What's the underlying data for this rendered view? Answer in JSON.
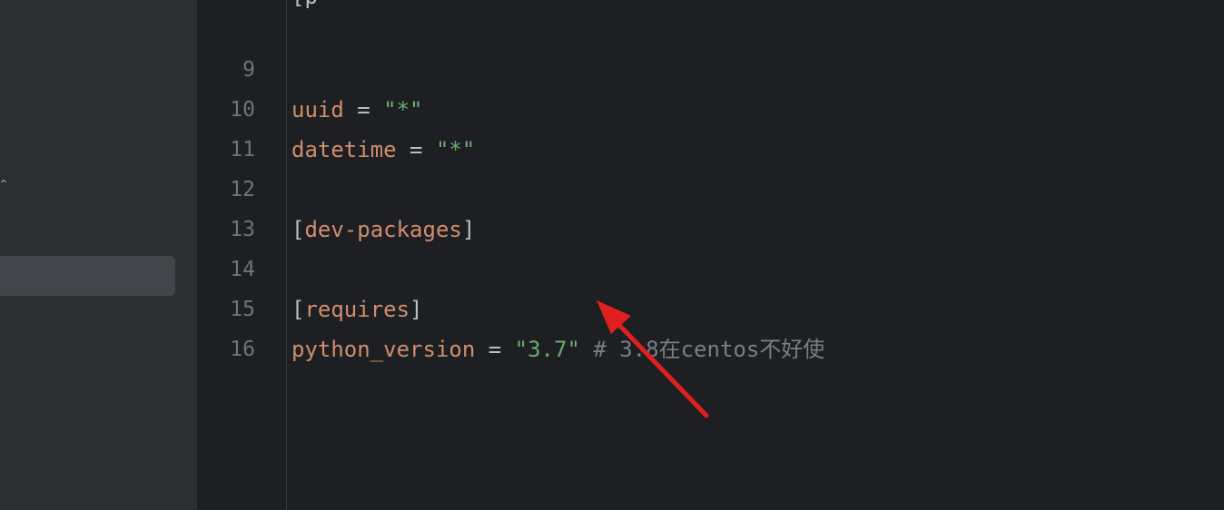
{
  "sidebar": {
    "glyph": "⌃"
  },
  "editor": {
    "lines": [
      {
        "number": "9",
        "key": "uuid",
        "op": " = ",
        "value": "\"*\""
      },
      {
        "number": "10",
        "key": "datetime",
        "op": " = ",
        "value": "\"*\""
      },
      {
        "number": "11"
      },
      {
        "number": "12",
        "open": "[",
        "section": "dev-packages",
        "close": "]"
      },
      {
        "number": "13"
      },
      {
        "number": "14",
        "open": "[",
        "section": "requires",
        "close": "]"
      },
      {
        "number": "15",
        "key": "python_version",
        "op": " = ",
        "value": "\"3.7\"",
        "comment_prefix": " # 3.8",
        "comment_cjk1": "在",
        "comment_mid": "centos",
        "comment_cjk2": "不好使"
      },
      {
        "number": "16"
      }
    ]
  },
  "annotation": {
    "arrow_color": "#e02020"
  },
  "colors": {
    "background": "#1e1f22",
    "sidebar": "#2b2d30",
    "keyword": "#cf8e6d",
    "string": "#6aab73",
    "comment": "#7a7e85",
    "line_number": "#6f737a"
  }
}
